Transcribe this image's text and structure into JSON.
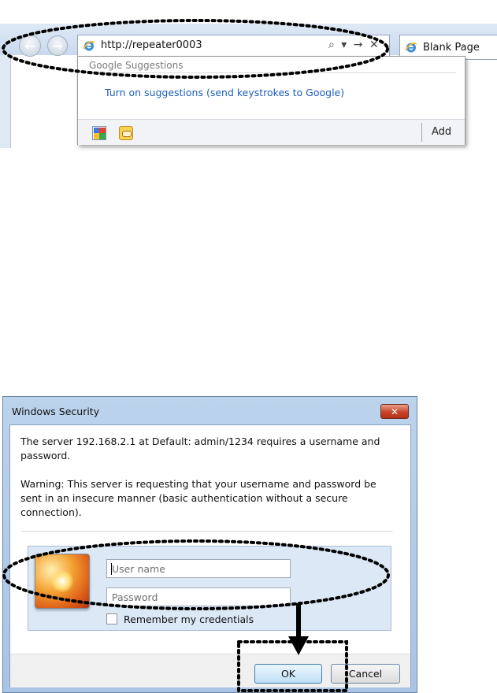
{
  "browser": {
    "address_value": "http://repeater0003",
    "address_tools": "⌕ ▾ → ✕",
    "back_glyph": "←",
    "forward_glyph": "→",
    "tab_label": "Blank Page",
    "suggestions": {
      "header": "Google Suggestions",
      "link_text": "Turn on suggestions (send keystrokes to Google)",
      "add_label": "Add"
    },
    "icons": [
      "ie-icon",
      "back-icon",
      "forward-icon",
      "search-icon",
      "dropdown-arrow-icon",
      "go-arrow-icon",
      "stop-icon",
      "google-provider-icon",
      "search-provider-icon"
    ]
  },
  "dialog": {
    "title": "Windows Security",
    "close_glyph": "✕",
    "message": "The server 192.168.2.1 at Default: admin/1234 requires a username and password.",
    "warning": "Warning: This server is requesting that your username and password be sent in an insecure manner (basic authentication without a secure connection).",
    "username_placeholder": "User name",
    "password_placeholder": "Password",
    "remember_label": "Remember my credentials",
    "remember_checked": false,
    "ok_label": "OK",
    "cancel_label": "Cancel",
    "colors": {
      "close_button": "#c8432a",
      "panel": "#dce8f6",
      "link": "#1f5fb8"
    }
  }
}
